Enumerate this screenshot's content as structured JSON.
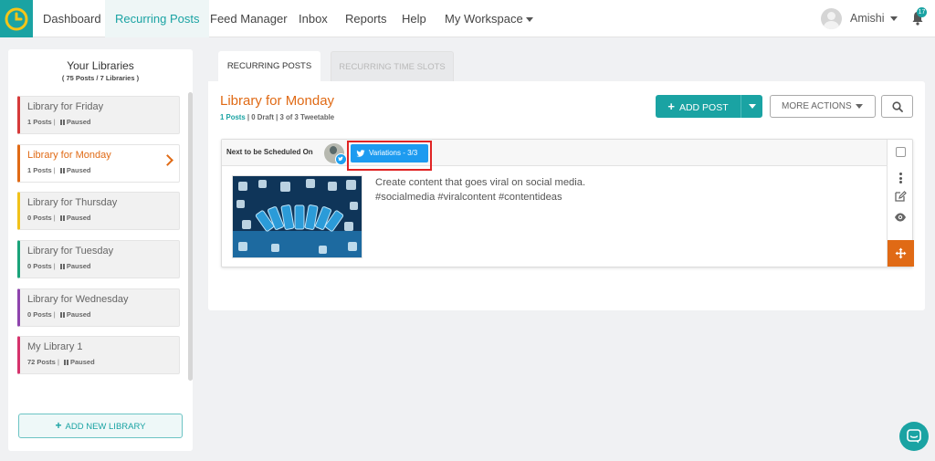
{
  "nav": {
    "items": [
      "Dashboard",
      "Recurring Posts",
      "Feed Manager",
      "Inbox",
      "Reports",
      "Help",
      "My Workspace"
    ],
    "active_index": 1,
    "user_name": "Amishi",
    "notification_count": "17"
  },
  "sidebar": {
    "title": "Your Libraries",
    "subtitle": "( 75 Posts / 7 Libraries )",
    "libraries": [
      {
        "name": "Library for Friday",
        "posts": "1 Posts",
        "status": "Paused",
        "color": "#d63a3a"
      },
      {
        "name": "Library for Monday",
        "posts": "1 Posts",
        "status": "Paused",
        "color": "#e06a15"
      },
      {
        "name": "Library for Thursday",
        "posts": "0 Posts",
        "status": "Paused",
        "color": "#f1c21b"
      },
      {
        "name": "Library for Tuesday",
        "posts": "0 Posts",
        "status": "Paused",
        "color": "#1aa37a"
      },
      {
        "name": "Library for Wednesday",
        "posts": "0 Posts",
        "status": "Paused",
        "color": "#8e44ad"
      },
      {
        "name": "My Library 1",
        "posts": "72 Posts",
        "status": "Paused",
        "color": "#d6336c"
      }
    ],
    "add_library_label": "ADD NEW LIBRARY"
  },
  "tabs": {
    "recurring_posts": "RECURRING POSTS",
    "recurring_time_slots": "RECURRING TIME SLOTS"
  },
  "library": {
    "title": "Library for Monday",
    "posts": "1 Posts",
    "draft": "0 Draft",
    "tweetable": "3 of 3 Tweetable",
    "add_post_label": "ADD POST",
    "more_actions_label": "MORE ACTIONS"
  },
  "post": {
    "next_label": "Next to be Scheduled On",
    "variations_label": "Variations - 3/3",
    "text_line1": "Create content that goes viral on social media.",
    "text_line2": "#socialmedia #viralcontent #contentideas"
  },
  "colors": {
    "accent": "#1aa3a3",
    "orange": "#e06a15",
    "twitter": "#1d9bf0",
    "highlight": "#e02424"
  }
}
